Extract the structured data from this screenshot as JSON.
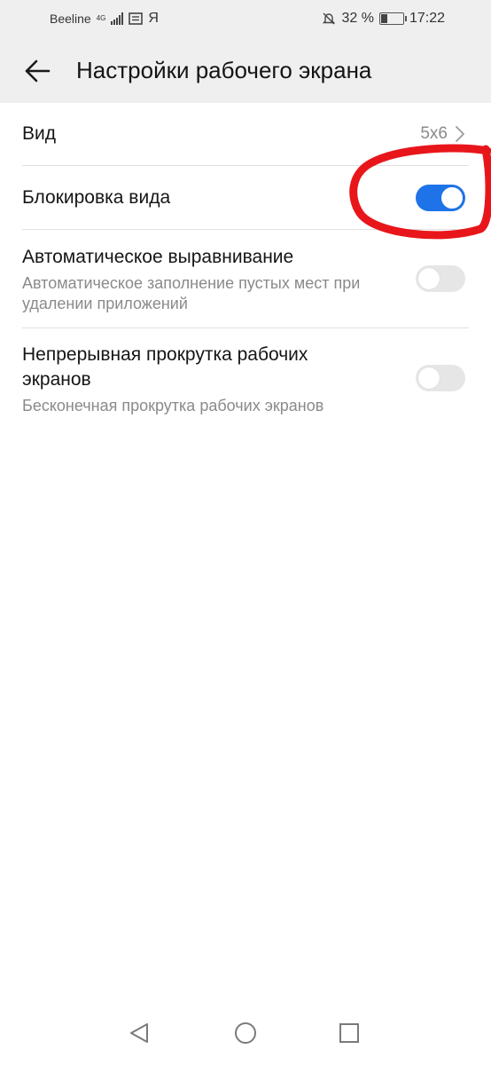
{
  "status_bar": {
    "carrier": "Beeline",
    "network": "4G",
    "app_indicator": "Я",
    "battery": "32 %",
    "battery_level": 0.32,
    "time": "17:22",
    "icons": [
      "signal-icon",
      "message-icon",
      "bell-off-icon",
      "battery-icon"
    ]
  },
  "app_bar": {
    "title": "Настройки рабочего экрана",
    "back_icon": "arrow-left-icon"
  },
  "settings": [
    {
      "title": "Вид",
      "value": "5x6",
      "type": "link"
    },
    {
      "title": "Блокировка вида",
      "type": "switch",
      "checked": true
    },
    {
      "title": "Автоматическое выравнивание",
      "subtitle": "Автоматическое заполнение пустых мест при удалении приложений",
      "type": "switch",
      "checked": false
    },
    {
      "title": "Непрерывная прокрутка рабочих экранов",
      "subtitle": "Бесконечная прокрутка рабочих экранов",
      "type": "switch",
      "checked": false
    }
  ],
  "colors": {
    "accent": "#1f73e8",
    "annotation": "#e8161b",
    "bar_background": "#efefef"
  },
  "nav_bar": {
    "icons": [
      "back-triangle-icon",
      "home-circle-icon",
      "recents-square-icon"
    ]
  }
}
